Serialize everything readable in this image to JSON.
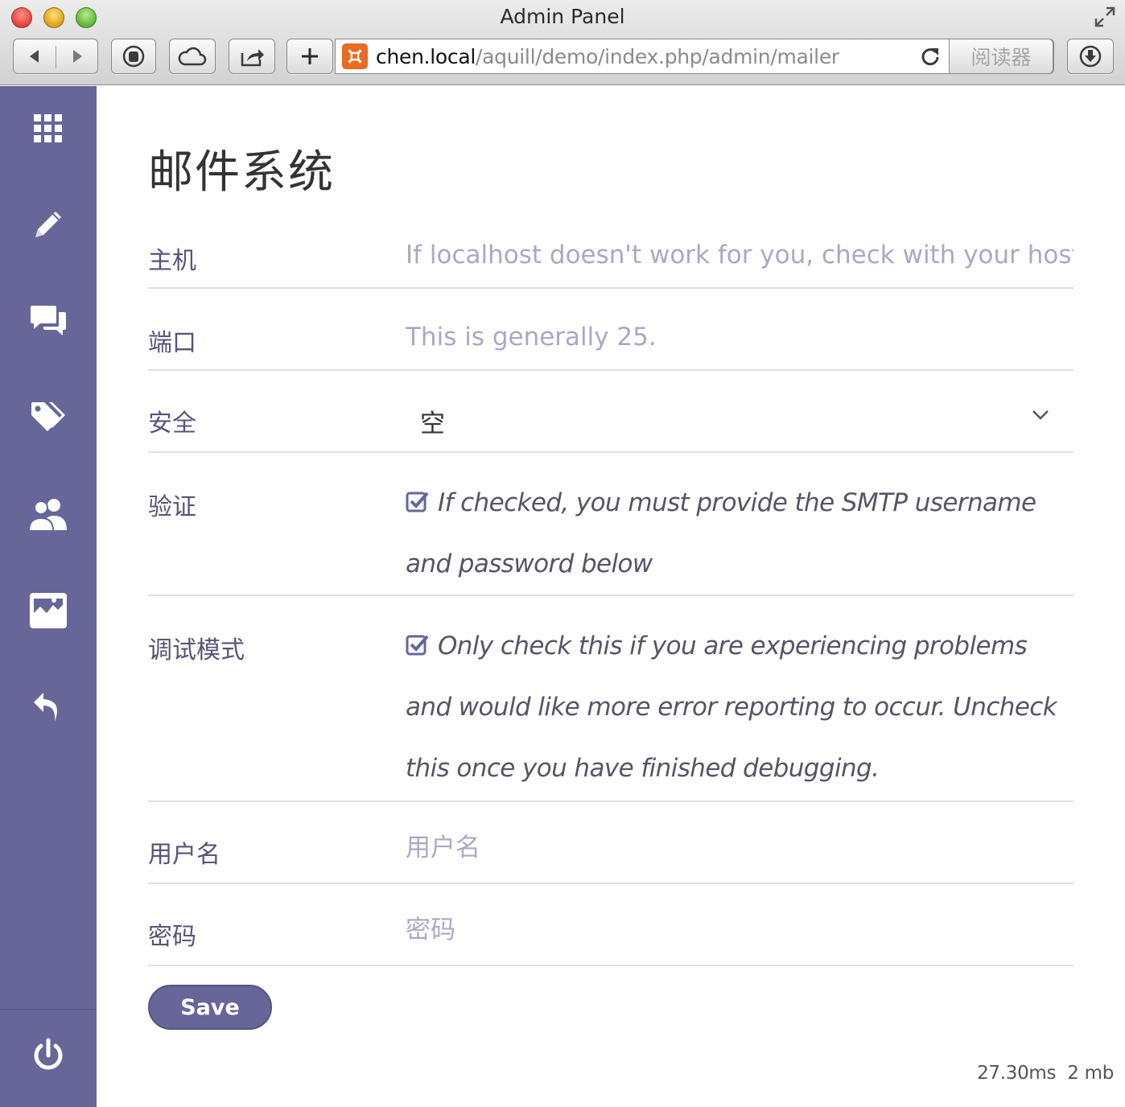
{
  "browser": {
    "window_title": "Admin Panel",
    "url_host": "chen.local",
    "url_path": "/aquill/demo/index.php/admin/mailer",
    "reader_label": "阅读器"
  },
  "sidebar": {
    "items": [
      {
        "icon": "grid-icon"
      },
      {
        "icon": "pencil-icon"
      },
      {
        "icon": "comments-icon"
      },
      {
        "icon": "tags-icon"
      },
      {
        "icon": "users-icon"
      },
      {
        "icon": "image-icon"
      },
      {
        "icon": "undo-icon"
      }
    ],
    "bottom_icon": "power-icon",
    "background": "#666699"
  },
  "page": {
    "title": "邮件系统"
  },
  "form": {
    "host": {
      "label": "主机",
      "placeholder": "If localhost doesn't work for you, check with your host for"
    },
    "port": {
      "label": "端口",
      "placeholder": "This is generally 25."
    },
    "security": {
      "label": "安全",
      "value": "空"
    },
    "auth": {
      "label": "验证",
      "checked": true,
      "text": "If checked, you must provide the SMTP username and password below"
    },
    "debug": {
      "label": "调试模式",
      "checked": true,
      "text": "Only check this if you are experiencing problems and would like more error reporting to occur. Uncheck this once you have finished debugging."
    },
    "username": {
      "label": "用户名",
      "placeholder": "用户名"
    },
    "password": {
      "label": "密码",
      "placeholder": "密码"
    },
    "save_label": "Save"
  },
  "footer": {
    "timing": "27.30ms",
    "memory": "2 mb"
  },
  "colors": {
    "accent": "#666699",
    "label": "#555577",
    "placeholder": "#a9a9c3"
  }
}
